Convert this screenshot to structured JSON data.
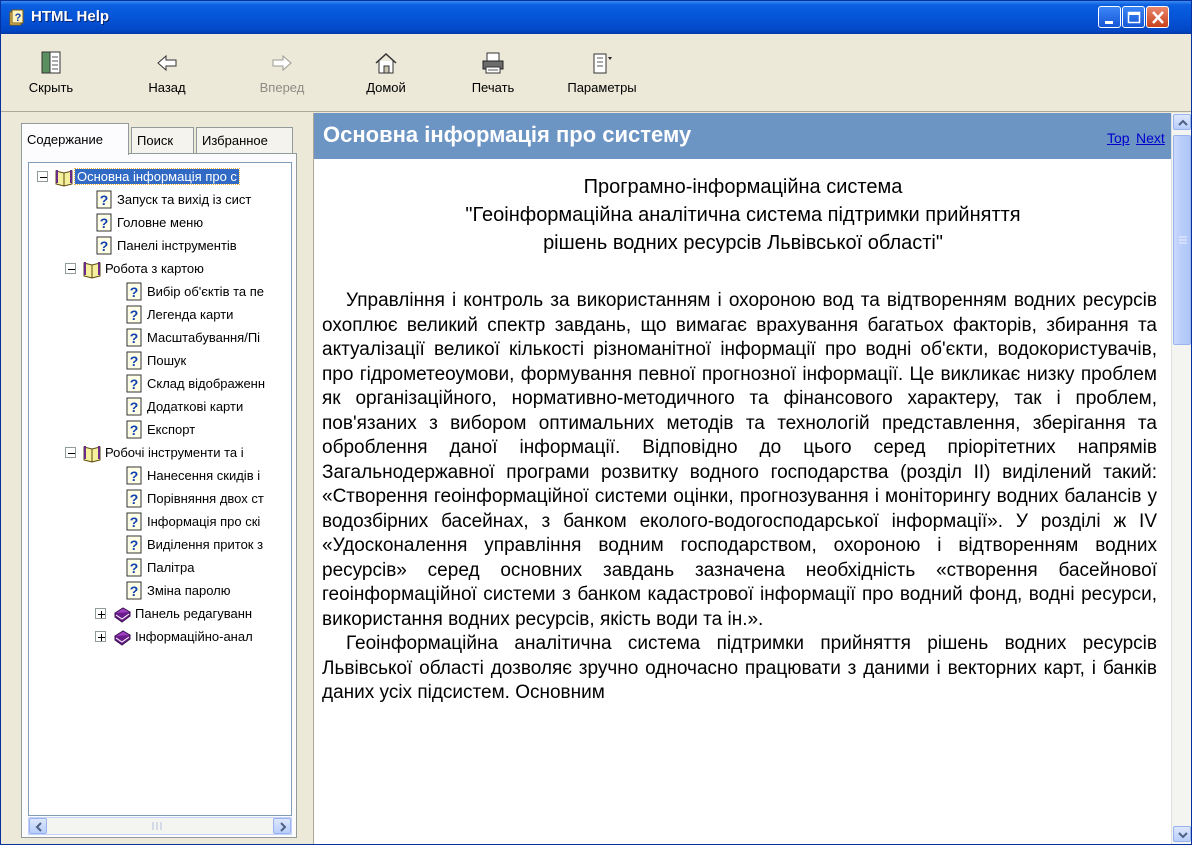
{
  "window": {
    "title": "HTML Help",
    "colors": {
      "titlebar": "#0654d8",
      "content_header": "#6c95c4",
      "link": "#0000cc",
      "selection": "#316ac5"
    }
  },
  "toolbar": {
    "hide": {
      "label": "Скрыть",
      "icon": "hide-pane-icon"
    },
    "back": {
      "label": "Назад",
      "icon": "back-arrow-icon"
    },
    "forward": {
      "label": "Вперед",
      "icon": "forward-arrow-icon",
      "enabled": false
    },
    "home": {
      "label": "Домой",
      "icon": "home-icon"
    },
    "print": {
      "label": "Печать",
      "icon": "printer-icon"
    },
    "options": {
      "label": "Параметры",
      "icon": "options-icon"
    }
  },
  "nav": {
    "tabs": [
      {
        "label": "Содержание",
        "active": true
      },
      {
        "label": "Поиск",
        "active": false
      },
      {
        "label": "Избранное",
        "active": false
      }
    ],
    "tree": [
      {
        "label": "Основна інформація про с",
        "icon": "open-book-icon",
        "expander": "minus",
        "selected": true
      },
      {
        "label": "Запуск та вихід із сист",
        "icon": "help-page-icon"
      },
      {
        "label": "Головне меню",
        "icon": "help-page-icon"
      },
      {
        "label": "Панелі інструментів",
        "icon": "help-page-icon"
      },
      {
        "label": "Робота з картою",
        "icon": "open-book-icon",
        "expander": "minus"
      },
      {
        "label": "Вибір об'єктів та пе",
        "icon": "help-page-icon"
      },
      {
        "label": "Легенда карти",
        "icon": "help-page-icon"
      },
      {
        "label": "Масштабування/Пі",
        "icon": "help-page-icon"
      },
      {
        "label": "Пошук",
        "icon": "help-page-icon"
      },
      {
        "label": "Склад відображенн",
        "icon": "help-page-icon"
      },
      {
        "label": "Додаткові карти",
        "icon": "help-page-icon"
      },
      {
        "label": "Експорт",
        "icon": "help-page-icon"
      },
      {
        "label": "Робочі інструменти та і",
        "icon": "open-book-icon",
        "expander": "minus"
      },
      {
        "label": "Нанесення скидів і",
        "icon": "help-page-icon"
      },
      {
        "label": "Порівняння двох ст",
        "icon": "help-page-icon"
      },
      {
        "label": "Інформація про скі",
        "icon": "help-page-icon"
      },
      {
        "label": "Виділення приток з",
        "icon": "help-page-icon"
      },
      {
        "label": "Палітра",
        "icon": "help-page-icon"
      },
      {
        "label": "Зміна паролю",
        "icon": "help-page-icon"
      },
      {
        "label": "Панель редагуванн",
        "icon": "closed-book-icon",
        "expander": "plus"
      },
      {
        "label": "Інформаційно-анал",
        "icon": "closed-book-icon",
        "expander": "plus"
      }
    ]
  },
  "content": {
    "title": "Основна інформація про систему",
    "links": {
      "top": "Top",
      "next": "Next"
    },
    "heading": [
      "Програмно-інформаційна система",
      "\"Геоінформаційна аналітична система підтримки прийняття",
      "рішень водних ресурсів Львівської області\""
    ],
    "paragraphs": [
      "Управління і контроль за використанням і охороною вод та відтворенням водних ресурсів охоплює великий спектр завдань, що вимагає врахування багатьох факторів, збирання та актуалізації великої кількості різноманітної інформації про водні об'єкти, водокористувачів, про гідрометеоумови, формування певної прогнозної інформації. Це викликає низку проблем як організаційного, нормативно-методичного та фінансового характеру, так і проблем, пов'язаних з вибором оптимальних методів та технологій представлення, зберігання та оброблення даної інформації. Відповідно до цього серед пріорітетних напрямів Загальнодержавної програми розвитку водного господарства (розділ II) виділений такий: «Створення геоінформаційної системи оцінки, прогнозування і моніторингу водних балансів у водозбірних басейнах, з банком еколого-водогосподарської інформації». У розділі ж IV «Удосконалення управління водним господарством, охороною і відтворенням водних ресурсів» серед основних завдань зазначена необхідність «створення басейнової геоінформаційної системи з банком кадастрової інформації про водний фонд, водні ресурси, використання водних ресурсів, якість води та ін.».",
      "Геоінформаційна аналітична система підтримки прийняття рішень водних ресурсів Львівської області дозволяє зручно одночасно працювати з даними і векторних карт, і банків даних усіх підсистем. Основним"
    ]
  }
}
